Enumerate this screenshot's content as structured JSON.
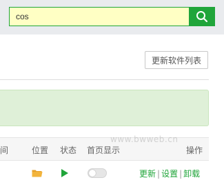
{
  "search": {
    "value": "cos",
    "icon": "search-icon"
  },
  "toolbar": {
    "refresh_label": "更新软件列表"
  },
  "table": {
    "columns": {
      "partial_left": "间",
      "location": "位置",
      "status": "状态",
      "homepage": "首页显示",
      "actions": "操作"
    },
    "row": {
      "location_icon": "folder-icon",
      "status_icon": "play-icon",
      "homepage_toggle": false,
      "actions": {
        "update": "更新",
        "separator": "|",
        "settings": "设置",
        "uninstall": "卸载"
      }
    }
  },
  "watermark": "www.bwweb.cn",
  "colors": {
    "accent": "#20a53a",
    "search_bg": "#ffffc4",
    "notice_bg": "#dff0d8",
    "folder": "#f2b43c"
  }
}
